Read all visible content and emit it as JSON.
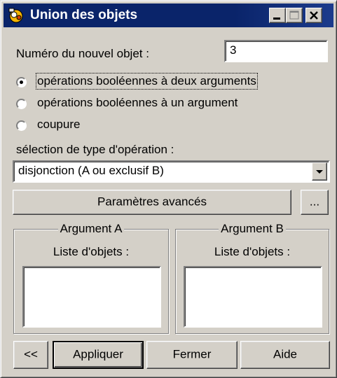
{
  "window": {
    "title": "Union des objets",
    "icon": "app-icon"
  },
  "object_number": {
    "label": "Numéro du nouvel objet :",
    "value": "3"
  },
  "operation_mode": {
    "options": [
      {
        "label": "opérations booléennes à deux arguments",
        "selected": true
      },
      {
        "label": "opérations booléennes à un argument",
        "selected": false
      },
      {
        "label": "coupure",
        "selected": false
      }
    ]
  },
  "operation_type": {
    "label": "sélection de type d'opération :",
    "selected": "disjonction (A ou exclusif B)"
  },
  "advanced": {
    "label": "Paramètres avancés",
    "more_label": "..."
  },
  "argument_a": {
    "title": "Argument A",
    "list_label": "Liste d'objets :"
  },
  "argument_b": {
    "title": "Argument B",
    "list_label": "Liste d'objets :"
  },
  "footer": {
    "back_label": "<<",
    "apply_label": "Appliquer",
    "close_label": "Fermer",
    "help_label": "Aide"
  }
}
